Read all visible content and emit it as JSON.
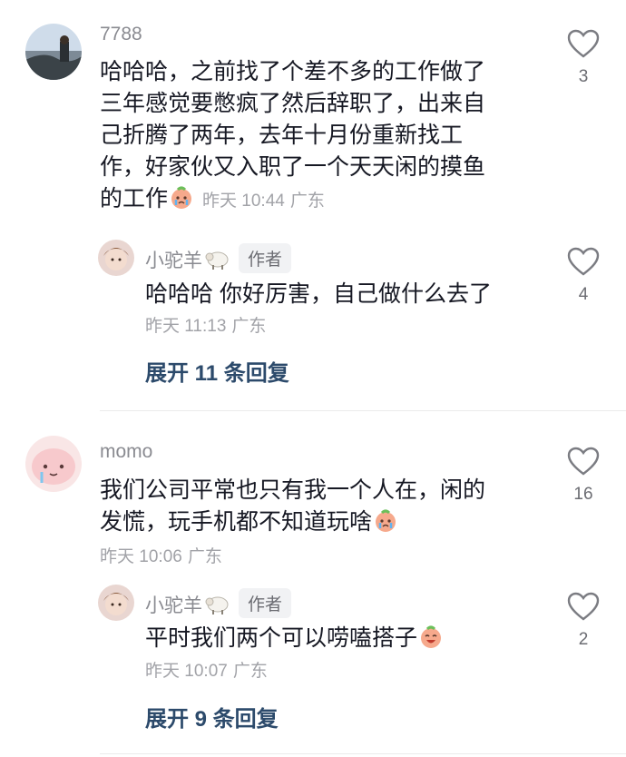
{
  "threads": [
    {
      "comment": {
        "username": "7788",
        "text_lines": [
          "哈哈哈，之前找了个差不多的工作做了",
          "三年感觉要憋疯了然后辞职了，出来自",
          "己折腾了两年，去年十月份重新找工",
          "作，好家伙又入职了一个天天闲的摸鱼"
        ],
        "last_line": "的工作",
        "emoji": "crying-face-emoji",
        "time": "昨天 10:44",
        "location": "广东",
        "likes": "3"
      },
      "reply": {
        "username": "小驼羊",
        "author_tag": "作者",
        "text": "哈哈哈 你好厉害，自己做什么去了",
        "time": "昨天 11:13",
        "location": "广东",
        "likes": "4"
      },
      "expand_label": "展开 11 条回复"
    },
    {
      "comment": {
        "username": "momo",
        "text_lines": [
          "我们公司平常也只有我一个人在，闲的"
        ],
        "last_line": "发慌，玩手机都不知道玩啥",
        "emoji": "crying-face-emoji",
        "time": "昨天 10:06",
        "location": "广东",
        "likes": "16"
      },
      "reply": {
        "username": "小驼羊",
        "author_tag": "作者",
        "text": "平时我们两个可以唠嗑搭子",
        "emoji": "grinning-face-emoji",
        "time": "昨天 10:07",
        "location": "广东",
        "likes": "2"
      },
      "expand_label": "展开 9 条回复"
    }
  ],
  "colors": {
    "text": "#161823",
    "meta": "#a2a3a8",
    "username": "#8a8b91",
    "expand": "#2c4a6b",
    "author_tag_bg": "#f1f2f4"
  }
}
